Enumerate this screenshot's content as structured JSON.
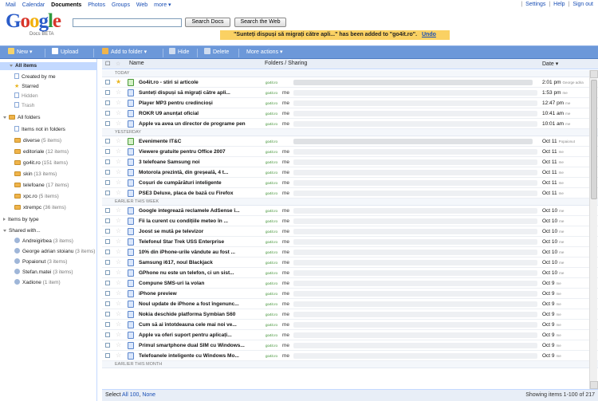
{
  "topnav": {
    "links": [
      "Mail",
      "Calendar",
      "Documents",
      "Photos",
      "Groups",
      "Web",
      "more ▾"
    ],
    "right": [
      "Settings",
      "Help",
      "Sign out"
    ]
  },
  "logo": {
    "word": "Google",
    "sub": "Docs BETA"
  },
  "search": {
    "placeholder": "",
    "docs_button": "Search Docs",
    "web_button": "Search the Web"
  },
  "notice": {
    "text": "\"Sunteți dispuși să migrați către apli...\" has been added to \"go4it.ro\".",
    "undo": "Undo"
  },
  "toolbar": {
    "new": "New ▾",
    "upload": "Upload",
    "add_to_folder": "Add to folder ▾",
    "hide": "Hide",
    "delete": "Delete",
    "more_actions": "More actions ▾"
  },
  "sidebar": {
    "all_items": "All items",
    "created_by_me": "Created by me",
    "starred": "Starred",
    "hidden": "Hidden",
    "trash": "Trash",
    "all_folders": "All folders",
    "folders": [
      {
        "label": "Items not in folders",
        "count": ""
      },
      {
        "label": "diverse",
        "count": "(5 items)"
      },
      {
        "label": "editoriale",
        "count": "(12 items)"
      },
      {
        "label": "go4it.ro",
        "count": "(151 items)"
      },
      {
        "label": "skin",
        "count": "(13 items)"
      },
      {
        "label": "telefoane",
        "count": "(17 items)"
      },
      {
        "label": "xpc.ro",
        "count": "(5 items)"
      },
      {
        "label": "xtrempc",
        "count": "(36 items)"
      }
    ],
    "items_by_type": "Items by type",
    "shared_with": "Shared with...",
    "people": [
      {
        "label": "Andreigirbea",
        "count": "(3 items)"
      },
      {
        "label": "George adrian stoianu",
        "count": "(3 items)"
      },
      {
        "label": "Popaionut",
        "count": "(3 items)"
      },
      {
        "label": "Stefan.matei",
        "count": "(3 items)"
      },
      {
        "label": "Xadione",
        "count": "(1 item)"
      }
    ]
  },
  "columns": {
    "name": "Name",
    "folders": "Folders / Sharing",
    "date": "Date ▾"
  },
  "groups": {
    "today": "TODAY",
    "yesterday": "YESTERDAY",
    "earlier_week": "EARLIER THIS WEEK",
    "earlier_month": "EARLIER THIS MONTH"
  },
  "rows": [
    {
      "name": "Go4it.ro - stiri si articole",
      "folder": "go4it.ro",
      "sharing": "",
      "date": "2:01 pm",
      "by": "George adria",
      "starred": true,
      "type": "s"
    },
    {
      "name": "Sunteți dispuși să migrați către apli...",
      "folder": "go4it.ro",
      "sharing": "me",
      "date": "1:53 pm",
      "by": "me",
      "starred": false,
      "type": "d"
    },
    {
      "name": "Player MP3 pentru credincioși",
      "folder": "go4it.ro",
      "sharing": "me",
      "date": "12:47 pm",
      "by": "me",
      "starred": false,
      "type": "d"
    },
    {
      "name": "ROKR U9 anunțat oficial",
      "folder": "go4it.ro",
      "sharing": "me",
      "date": "10:41 am",
      "by": "me",
      "starred": false,
      "type": "d"
    },
    {
      "name": "Apple va avea un director de programe pen",
      "folder": "go4it.ro",
      "sharing": "me",
      "date": "10:01 am",
      "by": "me",
      "starred": false,
      "type": "d"
    },
    {
      "name": "Evenimente IT&C",
      "folder": "go4it.ro",
      "sharing": "",
      "date": "Oct 11",
      "by": "Popaionut",
      "starred": false,
      "type": "s"
    },
    {
      "name": "Viewere gratuite pentru Office 2007",
      "folder": "go4it.ro",
      "sharing": "me",
      "date": "Oct 11",
      "by": "me",
      "starred": false,
      "type": "d"
    },
    {
      "name": "3 telefoane Samsung noi",
      "folder": "go4it.ro",
      "sharing": "me",
      "date": "Oct 11",
      "by": "me",
      "starred": false,
      "type": "d"
    },
    {
      "name": "Motorola prezintă, din greșeală, 4 t...",
      "folder": "go4it.ro",
      "sharing": "me",
      "date": "Oct 11",
      "by": "me",
      "starred": false,
      "type": "d"
    },
    {
      "name": "Coșuri de cumpărături inteligente",
      "folder": "go4it.ro",
      "sharing": "me",
      "date": "Oct 11",
      "by": "me",
      "starred": false,
      "type": "d"
    },
    {
      "name": "PSE3 Deluxe, placa de bază cu Firefox",
      "folder": "go4it.ro",
      "sharing": "me",
      "date": "Oct 11",
      "by": "me",
      "starred": false,
      "type": "d"
    },
    {
      "name": "Google integrează reclamele AdSense î...",
      "folder": "go4it.ro",
      "sharing": "me",
      "date": "Oct 10",
      "by": "me",
      "starred": false,
      "type": "d"
    },
    {
      "name": "Fii la curent cu condițiile meteo în ...",
      "folder": "go4it.ro",
      "sharing": "me",
      "date": "Oct 10",
      "by": "me",
      "starred": false,
      "type": "d"
    },
    {
      "name": "Joost se mută pe televizor",
      "folder": "go4it.ro",
      "sharing": "me",
      "date": "Oct 10",
      "by": "me",
      "starred": false,
      "type": "d"
    },
    {
      "name": "Telefonul Star Trek USS Enterprise",
      "folder": "go4it.ro",
      "sharing": "me",
      "date": "Oct 10",
      "by": "me",
      "starred": false,
      "type": "d"
    },
    {
      "name": "10% din iPhone-urile vândute au fost ...",
      "folder": "go4it.ro",
      "sharing": "me",
      "date": "Oct 10",
      "by": "me",
      "starred": false,
      "type": "d"
    },
    {
      "name": "Samsung i617, noul Blackjack",
      "folder": "go4it.ro",
      "sharing": "me",
      "date": "Oct 10",
      "by": "me",
      "starred": false,
      "type": "d"
    },
    {
      "name": "GPhone nu este un telefon, ci un sist...",
      "folder": "go4it.ro",
      "sharing": "me",
      "date": "Oct 10",
      "by": "me",
      "starred": false,
      "type": "d"
    },
    {
      "name": "Compune SMS-uri la volan",
      "folder": "go4it.ro",
      "sharing": "me",
      "date": "Oct 9",
      "by": "me",
      "starred": false,
      "type": "d"
    },
    {
      "name": "iPhone preview",
      "folder": "go4it.ro",
      "sharing": "me",
      "date": "Oct 9",
      "by": "me",
      "starred": false,
      "type": "d"
    },
    {
      "name": "Noul update de iPhone a fost îngenunc...",
      "folder": "go4it.ro",
      "sharing": "me",
      "date": "Oct 9",
      "by": "me",
      "starred": false,
      "type": "d"
    },
    {
      "name": "Nokia deschide platforma Symbian S60",
      "folder": "go4it.ro",
      "sharing": "me",
      "date": "Oct 9",
      "by": "me",
      "starred": false,
      "type": "d"
    },
    {
      "name": "Cum să ai întotdeauna cele mai noi ve...",
      "folder": "go4it.ro",
      "sharing": "me",
      "date": "Oct 9",
      "by": "me",
      "starred": false,
      "type": "d"
    },
    {
      "name": "Apple va oferi suport pentru aplicați...",
      "folder": "go4it.ro",
      "sharing": "me",
      "date": "Oct 9",
      "by": "me",
      "starred": false,
      "type": "d"
    },
    {
      "name": "Primul smartphone dual SIM cu Windows...",
      "folder": "go4it.ro",
      "sharing": "me",
      "date": "Oct 9",
      "by": "me",
      "starred": false,
      "type": "d"
    },
    {
      "name": "Telefoanele inteligente cu Windows Mo...",
      "folder": "go4it.ro",
      "sharing": "me",
      "date": "Oct 9",
      "by": "me",
      "starred": false,
      "type": "d"
    }
  ],
  "footer": {
    "select": "Select",
    "all": "All 100",
    "none": "None",
    "showing": "Showing items 1-100 of 217"
  },
  "colors": {
    "toolbar": "#6c98d9",
    "selection": "#c3d9ff",
    "notice": "#fad163",
    "link": "#1a4fb5"
  }
}
